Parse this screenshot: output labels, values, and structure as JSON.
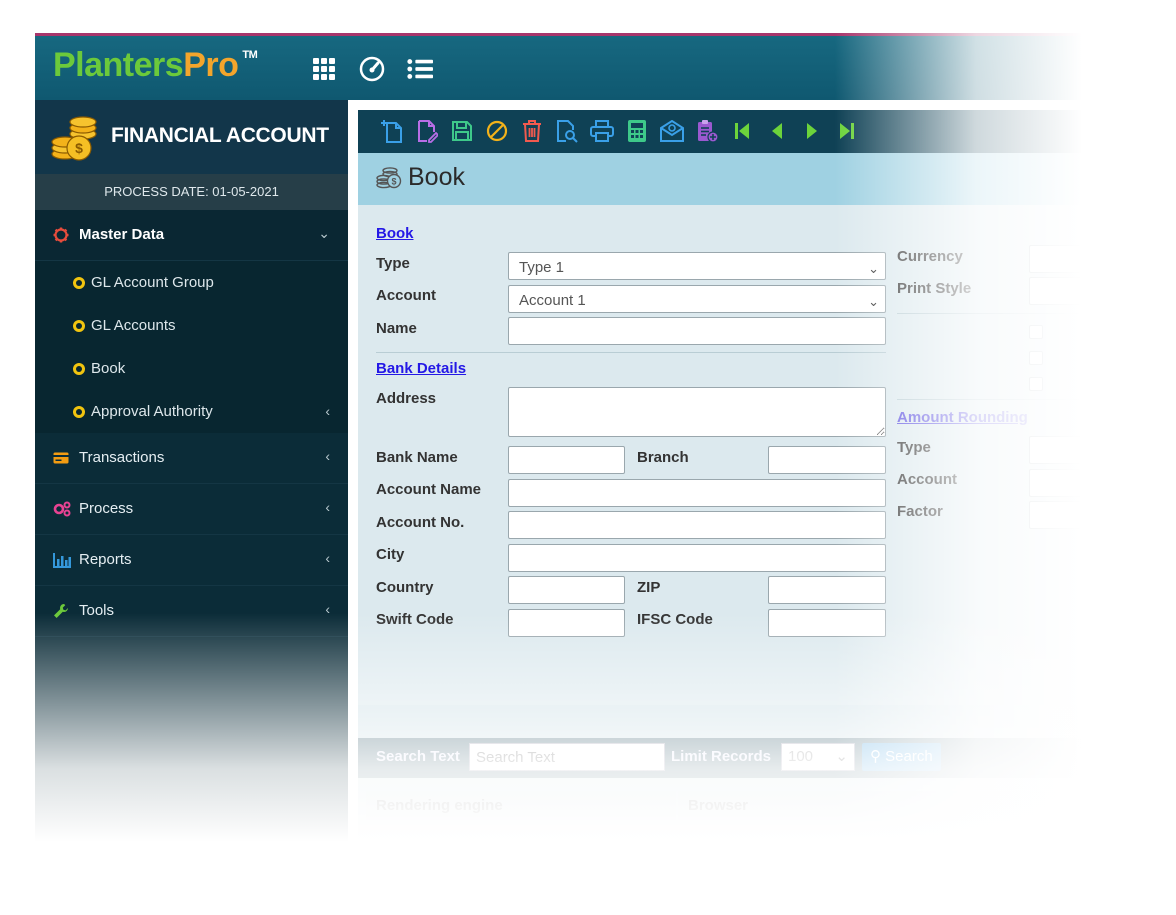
{
  "brand": {
    "name_green": "Planters",
    "name_orange": "Pro",
    "tm": "TM"
  },
  "topbar": {
    "icons": [
      "grid-icon",
      "dashboard-gauge-icon",
      "list-icon"
    ]
  },
  "sidebar": {
    "title": "FINANCIAL ACCOUNT",
    "process_date": "PROCESS DATE: 01-05-2021",
    "menu": [
      {
        "label": "Master Data",
        "icon": "gear-icon",
        "expanded": true,
        "color": "#e74c3c"
      },
      {
        "label": "Transactions",
        "icon": "card-icon",
        "color": "#f39c12"
      },
      {
        "label": "Process",
        "icon": "cogs-icon",
        "color": "#e84393"
      },
      {
        "label": "Reports",
        "icon": "bar-chart-icon",
        "color": "#3498db"
      },
      {
        "label": "Tools",
        "icon": "wrench-icon",
        "color": "#6cc93b"
      }
    ],
    "submenu": [
      {
        "label": "GL Account Group"
      },
      {
        "label": "GL Accounts"
      },
      {
        "label": "Book"
      },
      {
        "label": "Approval Authority",
        "has_children": true
      }
    ]
  },
  "toolbar": {
    "icons": [
      {
        "name": "new-document-icon",
        "color": "#3aa0e8"
      },
      {
        "name": "edit-document-icon",
        "color": "#b86ee6"
      },
      {
        "name": "save-icon",
        "color": "#3ec98a"
      },
      {
        "name": "cancel-icon",
        "color": "#f3b21a"
      },
      {
        "name": "delete-icon",
        "color": "#f15a4f"
      },
      {
        "name": "preview-document-icon",
        "color": "#3aa0e8"
      },
      {
        "name": "print-icon",
        "color": "#3aa0e8"
      },
      {
        "name": "calculator-icon",
        "color": "#3ec98a"
      },
      {
        "name": "email-icon",
        "color": "#3aa0e8"
      },
      {
        "name": "attachment-document-icon",
        "color": "#9b59d0"
      },
      {
        "name": "first-record-icon",
        "color": "#6cd33b"
      },
      {
        "name": "previous-record-icon",
        "color": "#6cd33b"
      },
      {
        "name": "next-record-icon",
        "color": "#6cd33b"
      },
      {
        "name": "last-record-icon",
        "color": "#6cd33b"
      }
    ]
  },
  "panel": {
    "title": "Book"
  },
  "form": {
    "book_section": "Book",
    "type_label": "Type",
    "type_value": "Type 1",
    "account_label": "Account",
    "account_value": "Account 1",
    "name_label": "Name",
    "bank_section": "Bank Details",
    "address_label": "Address",
    "bank_name_label": "Bank Name",
    "branch_label": "Branch",
    "account_name_label": "Account Name",
    "account_no_label": "Account No.",
    "city_label": "City",
    "country_label": "Country",
    "zip_label": "ZIP",
    "swift_label": "Swift Code",
    "ifsc_label": "IFSC Code",
    "currency_label": "Currency",
    "print_style_label": "Print Style",
    "amount_rounding_section": "Amount Rounding",
    "ar_type_label": "Type",
    "ar_account_label": "Account",
    "factor_label": "Factor"
  },
  "search": {
    "label": "Search Text",
    "placeholder": "Search Text",
    "limit_label": "Limit Records",
    "limit_value": "100",
    "button": "Search"
  },
  "grid": {
    "columns": [
      "Rendering engine",
      "Browser"
    ]
  }
}
